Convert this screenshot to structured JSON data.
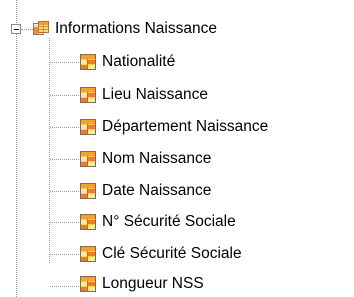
{
  "tree": {
    "parent": {
      "label": "Informations Naissance",
      "expanded": true,
      "icon": "table-group-icon"
    },
    "children": [
      {
        "label": "Nationalité",
        "icon": "table-field-icon"
      },
      {
        "label": "Lieu Naissance",
        "icon": "table-field-icon"
      },
      {
        "label": "Département Naissance",
        "icon": "table-field-icon"
      },
      {
        "label": "Nom Naissance",
        "icon": "table-field-icon"
      },
      {
        "label": "Date Naissance",
        "icon": "table-field-icon"
      },
      {
        "label": "N° Sécurité Sociale",
        "icon": "table-field-icon"
      },
      {
        "label": "Clé Sécurité Sociale",
        "icon": "table-field-icon"
      },
      {
        "label": "Longueur NSS",
        "icon": "table-field-icon"
      }
    ]
  },
  "colors": {
    "connector": "#9a9a9a",
    "icon_orange": "#f5a030",
    "icon_yellow": "#ffd24a",
    "icon_red": "#d85a30",
    "icon_border": "#8a6a40"
  }
}
